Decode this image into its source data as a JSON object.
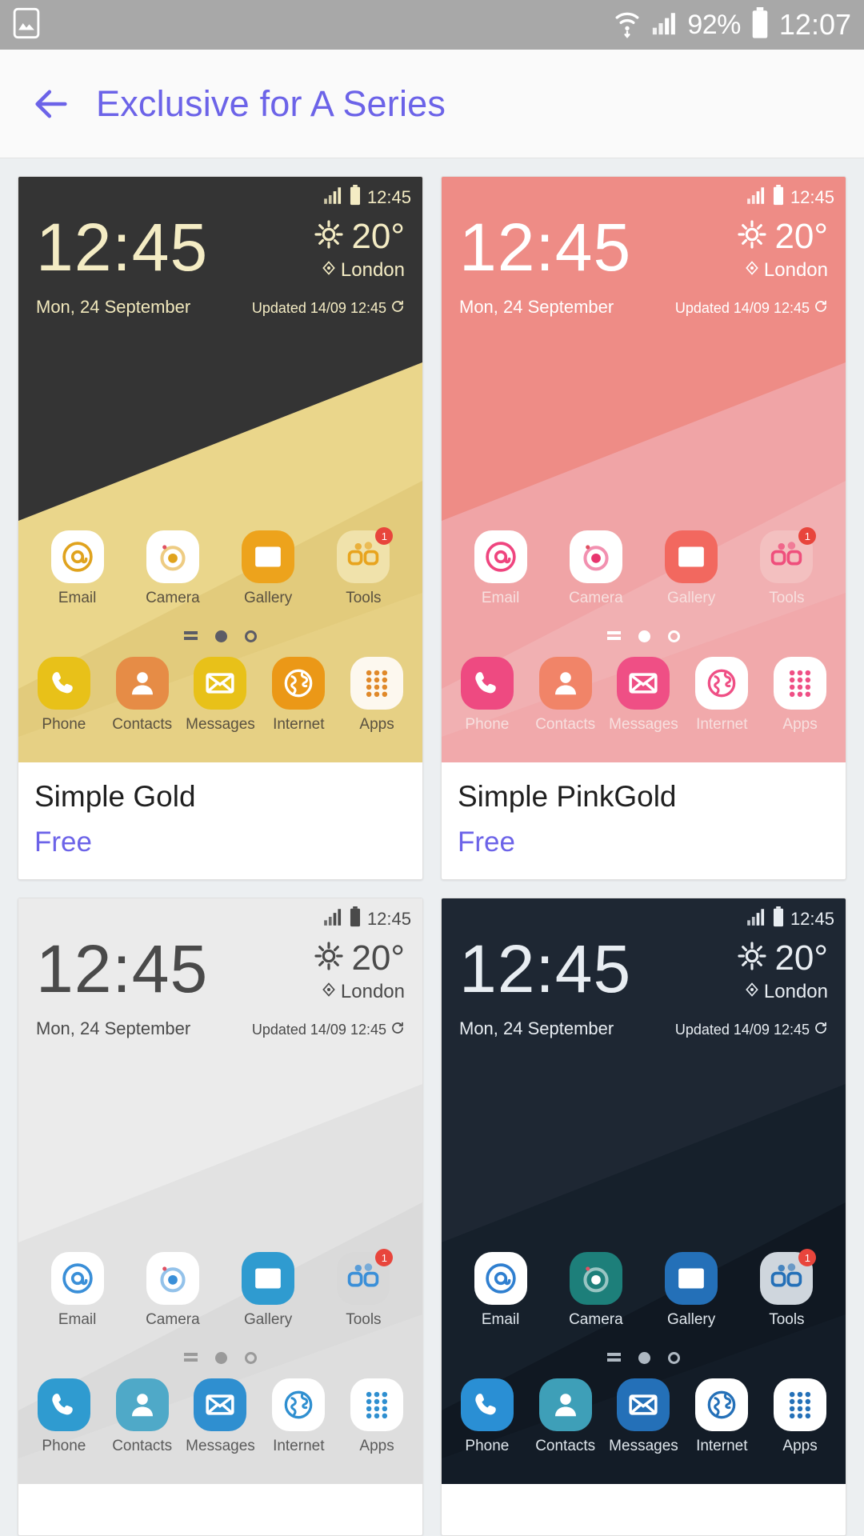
{
  "statusbar": {
    "left_icon": "gallery-image-icon",
    "wifi_icon": "wifi-icon",
    "signal_icon": "cellular-signal-icon",
    "battery_percent": "92%",
    "battery_icon": "battery-icon",
    "clock": "12:07"
  },
  "header": {
    "back_icon": "back-arrow-icon",
    "title": "Exclusive for A Series"
  },
  "preview_common": {
    "status_time": "12:45",
    "clock": "12:45",
    "date": "Mon, 24 September",
    "temp": "20°",
    "location": "London",
    "updated": "Updated 14/09 12:45",
    "sun_icon": "sun-weather-icon",
    "pin_icon": "location-pin-icon",
    "refresh_icon": "refresh-icon",
    "signal_icon": "cellular-signal-icon",
    "battery_icon": "battery-icon",
    "apps": [
      {
        "label": "Email",
        "icon": "email-at-icon"
      },
      {
        "label": "Camera",
        "icon": "camera-icon"
      },
      {
        "label": "Gallery",
        "icon": "gallery-image-icon"
      },
      {
        "label": "Tools",
        "icon": "tools-folder-icon",
        "badge": "1"
      }
    ],
    "dock": [
      {
        "label": "Phone",
        "icon": "phone-handset-icon"
      },
      {
        "label": "Contacts",
        "icon": "contacts-person-icon"
      },
      {
        "label": "Messages",
        "icon": "messages-envelope-icon"
      },
      {
        "label": "Internet",
        "icon": "internet-globe-icon"
      },
      {
        "label": "Apps",
        "icon": "apps-grid-icon"
      }
    ],
    "page_indicator": {
      "bars_icon": "page-list-icon",
      "active_dot": "page-dot-active",
      "inactive_dot": "page-dot-inactive"
    }
  },
  "themes": [
    {
      "title": "Simple Gold",
      "price": "Free",
      "colors": {
        "bg_top": "#343434",
        "wall_a": "#343434",
        "wall_b": "#ead68b",
        "wall_c": "#e2cb7c",
        "text": "#f4ecc4",
        "date_text": "#f1e8bc",
        "app_label": "#5a5140",
        "dock_label": "#5a5140",
        "icon_email_bg": "#ffffff",
        "icon_email_fg": "#e0a31e",
        "icon_camera_bg": "#ffffff",
        "icon_camera_fg": "#e0a31e",
        "icon_gallery_bg": "#eda31c",
        "icon_gallery_fg": "#ffffff",
        "icon_tools_bg": "#f0e2ab",
        "icon_tools_fg": "#e8a41e",
        "dock_phone": "#e8c119",
        "dock_contacts": "#e68c46",
        "dock_messages": "#e8c119",
        "dock_internet": "#eb9817",
        "dock_apps": "#fdf8ef",
        "dock_apps_fg": "#e0892a",
        "dot": "#5c5c66"
      }
    },
    {
      "title": "Simple PinkGold",
      "price": "Free",
      "colors": {
        "bg_top": "#ee8c86",
        "wall_a": "#ee8c86",
        "wall_b": "#f0a4a6",
        "wall_c": "#f1b0b2",
        "text": "#ffffff",
        "date_text": "#ffffff",
        "app_label": "#f7e0df",
        "dock_label": "#f7e0df",
        "icon_email_bg": "#ffffff",
        "icon_email_fg": "#ef457f",
        "icon_camera_bg": "#ffffff",
        "icon_camera_fg": "#e8356f",
        "icon_gallery_bg": "#f2685f",
        "icon_gallery_fg": "#ffffff",
        "icon_tools_bg": "#f3c0c0",
        "icon_tools_fg": "#ef4f7c",
        "dock_phone": "#ee4a81",
        "dock_contacts": "#f18468",
        "dock_messages": "#ef4f85",
        "dock_internet": "#ffffff",
        "dock_apps": "#ffffff",
        "dock_apps_fg": "#ef4f85",
        "dot": "#ffffff"
      }
    },
    {
      "title": "",
      "price": "",
      "colors": {
        "bg_top": "#ebebeb",
        "wall_a": "#ebebeb",
        "wall_b": "#e2e2e2",
        "wall_c": "#dadada",
        "text": "#4a4a4a",
        "date_text": "#4a4a4a",
        "app_label": "#5a5a5a",
        "dock_label": "#5a5a5a",
        "icon_email_bg": "#ffffff",
        "icon_email_fg": "#3a8fd8",
        "icon_camera_bg": "#ffffff",
        "icon_camera_fg": "#3a8fd8",
        "icon_gallery_bg": "#2f9bd0",
        "icon_gallery_fg": "#ffffff",
        "icon_tools_bg": "#d8d8d8",
        "icon_tools_fg": "#3a8fd8",
        "dock_phone": "#2f9bd0",
        "dock_contacts": "#4fa9c8",
        "dock_messages": "#2f8fd0",
        "dock_internet": "#ffffff",
        "dock_apps": "#ffffff",
        "dock_apps_fg": "#2f8fd0",
        "dot": "#9a9a9a"
      }
    },
    {
      "title": "",
      "price": "",
      "colors": {
        "bg_top": "#1e2733",
        "wall_a": "#1e2733",
        "wall_b": "#16202b",
        "wall_c": "#101822",
        "text": "#e8edf2",
        "date_text": "#e8edf2",
        "app_label": "#dfe6ec",
        "dock_label": "#dfe6ec",
        "icon_email_bg": "#ffffff",
        "icon_email_fg": "#2f7fd0",
        "icon_camera_bg": "#1d7f7a",
        "icon_camera_fg": "#ffffff",
        "icon_gallery_bg": "#2470b8",
        "icon_gallery_fg": "#ffffff",
        "icon_tools_bg": "#cfd6dd",
        "icon_tools_fg": "#2470b8",
        "dock_phone": "#2a8fd4",
        "dock_contacts": "#3e9fb8",
        "dock_messages": "#2470b8",
        "dock_internet": "#ffffff",
        "dock_apps": "#ffffff",
        "dock_apps_fg": "#2470b8",
        "dot": "#aeb8c2"
      }
    }
  ]
}
